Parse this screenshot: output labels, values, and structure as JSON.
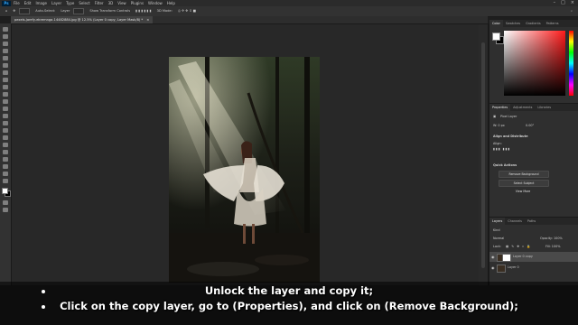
{
  "app": {
    "logo": "Ps"
  },
  "menu": [
    "File",
    "Edit",
    "Image",
    "Layer",
    "Type",
    "Select",
    "Filter",
    "3D",
    "View",
    "Plugins",
    "Window",
    "Help"
  ],
  "options_bar": {
    "auto_select_label": "Auto-Select:",
    "layer_value": "Layer",
    "transform_label": "Show Transform Controls",
    "mode_label": "3D Mode:"
  },
  "document_tab": {
    "title": "pexels-jarefy-ekremnga-14482884.jpg @ 12.5% (Layer 0 copy, Layer Mask/8) *",
    "close": "×"
  },
  "right_panels": {
    "color_tabs": [
      "Color",
      "Swatches",
      "Gradients",
      "Patterns"
    ],
    "properties_tabs": [
      "Properties",
      "Adjustments",
      "Libraries"
    ],
    "pixel_layer_label": "Pixel Layer",
    "transform_values": {
      "w": "W: 0 px",
      "angle": "0.00°"
    },
    "align_title": "Align and Distribute",
    "align_sub": "Align:",
    "quick_actions_title": "Quick Actions",
    "buttons": [
      "Remove Background",
      "Select Subject",
      "View More"
    ],
    "layers_tabs": [
      "Layers",
      "Channels",
      "Paths"
    ],
    "kind_label": "Kind",
    "blend_mode": "Normal",
    "opacity_label": "Opacity: 100%",
    "lock_label": "Lock:",
    "fill_label": "Fill: 100%",
    "layers": [
      {
        "name": "Layer 0 copy",
        "active": true
      },
      {
        "name": "Layer 0",
        "active": false
      }
    ]
  },
  "caption": {
    "line1": "Unlock the layer and copy it;",
    "line2": "Click on the copy layer, go to (Properties), and click on (Remove Background);"
  }
}
